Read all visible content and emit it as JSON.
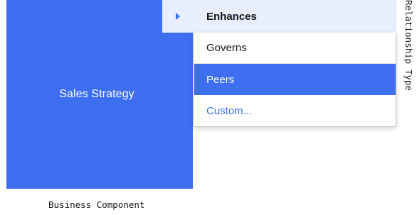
{
  "component": {
    "name": "Sales Strategy",
    "color": "#3d6ff0"
  },
  "dropdown": {
    "expand_icon": "caret-right-icon",
    "header_label": "Enhances",
    "items": [
      {
        "label": "Governs",
        "selected": false
      },
      {
        "label": "Peers",
        "selected": true
      },
      {
        "label": "Custom...",
        "selected": false
      }
    ],
    "accent_color": "#3d6ff0",
    "header_bg": "#e8eefd"
  },
  "axes": {
    "x_label": "Business Component",
    "y_label": "Relationship Type"
  }
}
